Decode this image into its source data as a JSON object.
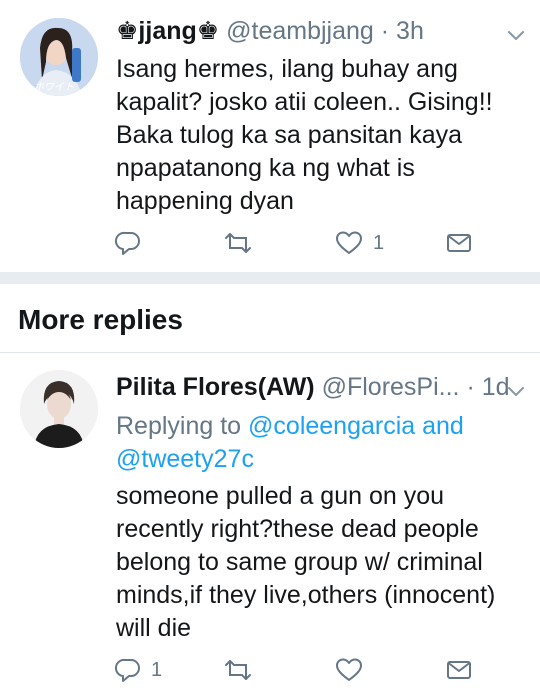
{
  "tweet1": {
    "display_name_prefix": "♚",
    "display_name": "jjang",
    "display_name_suffix": "♚",
    "handle": "@teambjjang",
    "time": " · 3h",
    "text_lines": [
      "Isang hermes, ilang buhay ang",
      "kapalit? josko atii coleen.. Gising!!",
      "Baka tulog ka sa pansitan kaya",
      "npapatanong ka ng what is",
      "happening dyan"
    ],
    "like_count": "1"
  },
  "section": {
    "title": "More replies"
  },
  "tweet2": {
    "display_name": "Pilita Flores(AW)",
    "handle": "@FloresPi...",
    "time": " · 1d",
    "replying_label": "Replying to ",
    "replying_user1": "@coleengarcia",
    "replying_and": " and",
    "replying_user2": "@tweety27c",
    "text_lines": [
      "someone pulled a gun on you",
      "recently right?these dead people",
      "belong to same group w/ criminal",
      "minds,if they live,others (innocent)",
      "will die"
    ],
    "reply_count": "1"
  },
  "colors": {
    "accent": "#1da1f2",
    "secondary_text": "#657786",
    "divider": "#e6ecf0"
  }
}
